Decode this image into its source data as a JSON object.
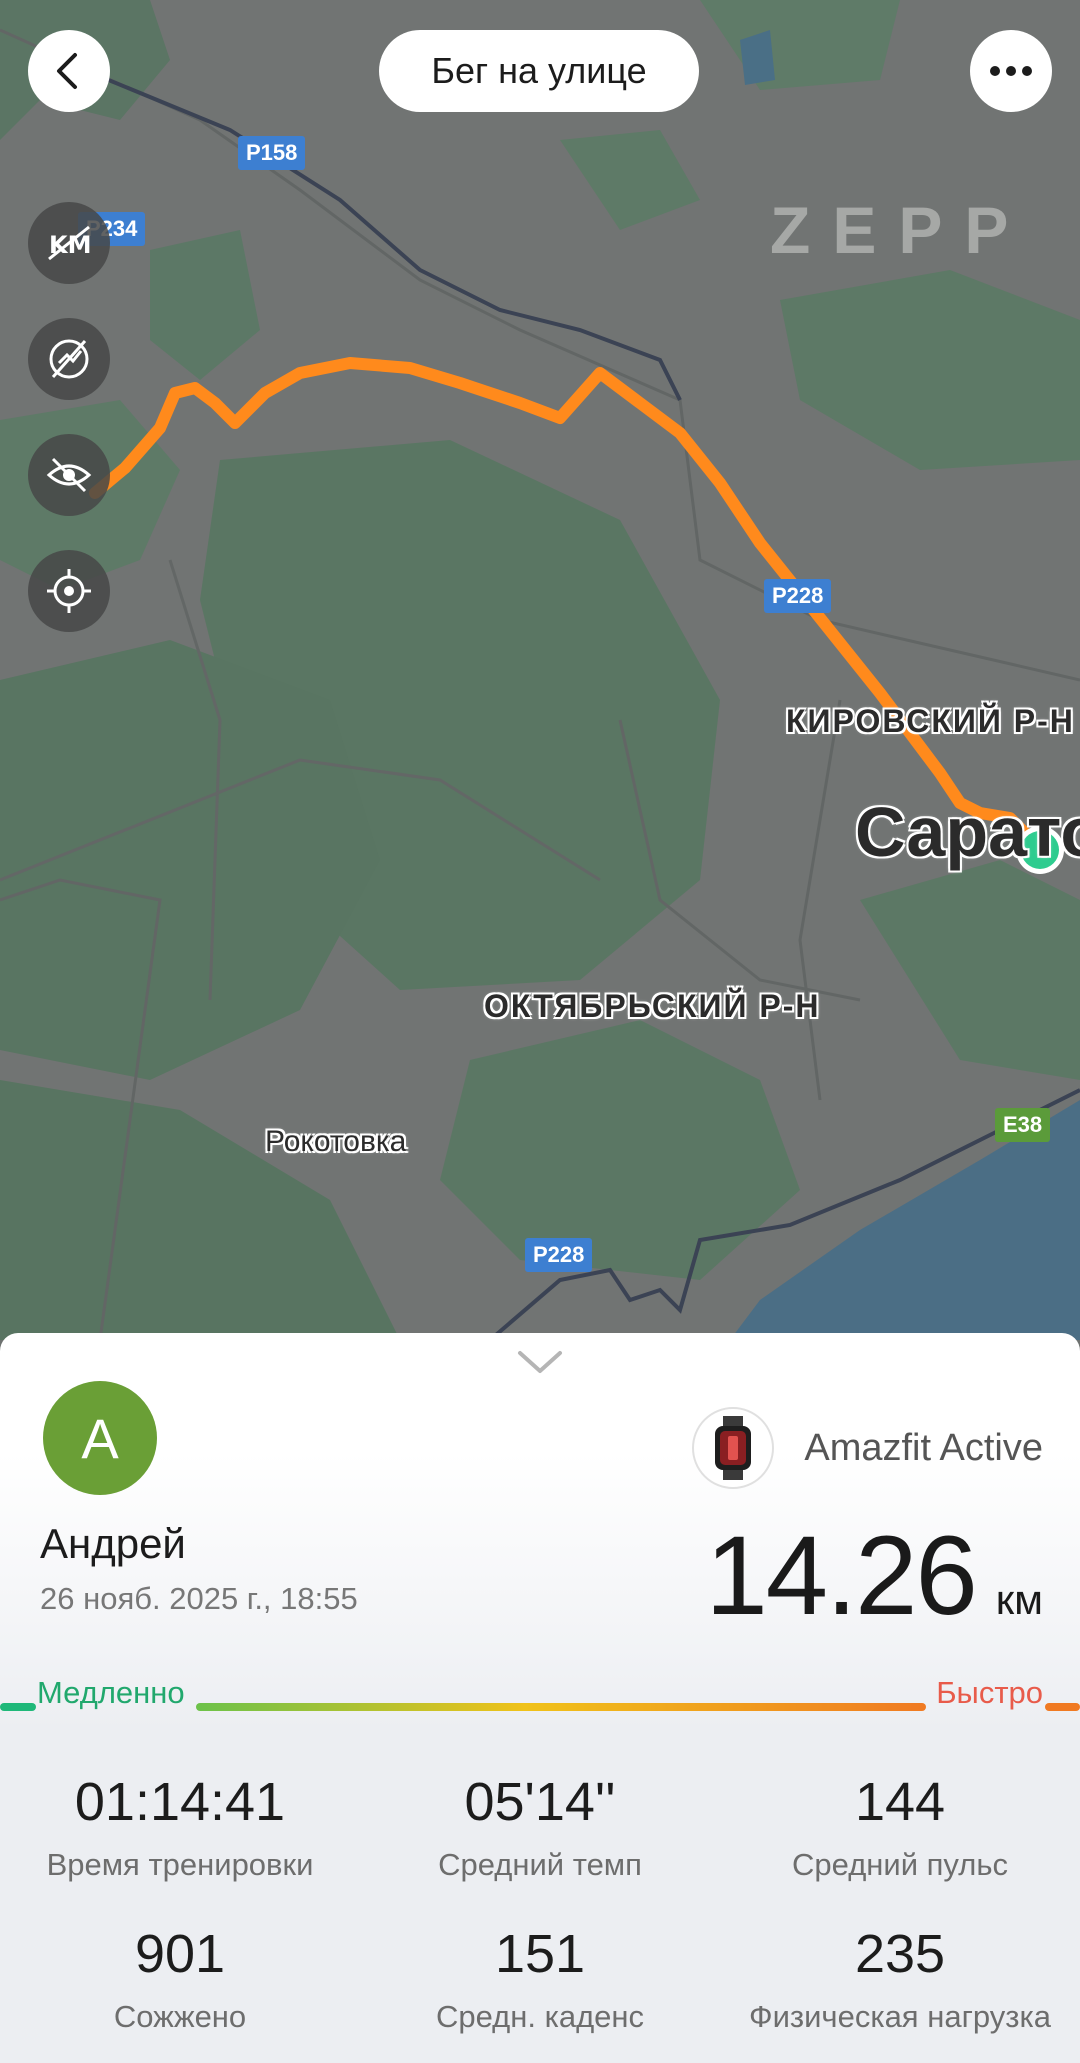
{
  "header": {
    "title": "Бег на улице"
  },
  "map": {
    "logo": "ZEPP",
    "roads": [
      "P158",
      "P234",
      "P228",
      "P228",
      "E38"
    ],
    "places": [
      "КИРОВСКИЙ Р-Н",
      "Сарато",
      "ОКТЯБРЬСКИЙ Р-Н",
      "Рокотовка"
    ],
    "tools": [
      "km-markers-icon",
      "hide-pace-icon",
      "hide-view-icon",
      "locate-icon"
    ],
    "route_color": "#ff8a1c",
    "end_marker_color": "#2ecc8f"
  },
  "user": {
    "avatar_letter": "А",
    "name": "Андрей",
    "date": "26 нояб. 2025 г., 18:55"
  },
  "device": {
    "name": "Amazfit Active"
  },
  "summary": {
    "distance": "14.26",
    "unit": "км"
  },
  "pace_legend": {
    "slow": "Медленно",
    "fast": "Быстро"
  },
  "stats": [
    {
      "value": "01:14:41",
      "label": "Время тренировки"
    },
    {
      "value": "05'14''",
      "label": "Средний темп"
    },
    {
      "value": "144",
      "label": "Средний пульс"
    },
    {
      "value": "901",
      "label": "Сожжено"
    },
    {
      "value": "151",
      "label": "Средн. каденс"
    },
    {
      "value": "235",
      "label": "Физическая нагрузка"
    }
  ]
}
